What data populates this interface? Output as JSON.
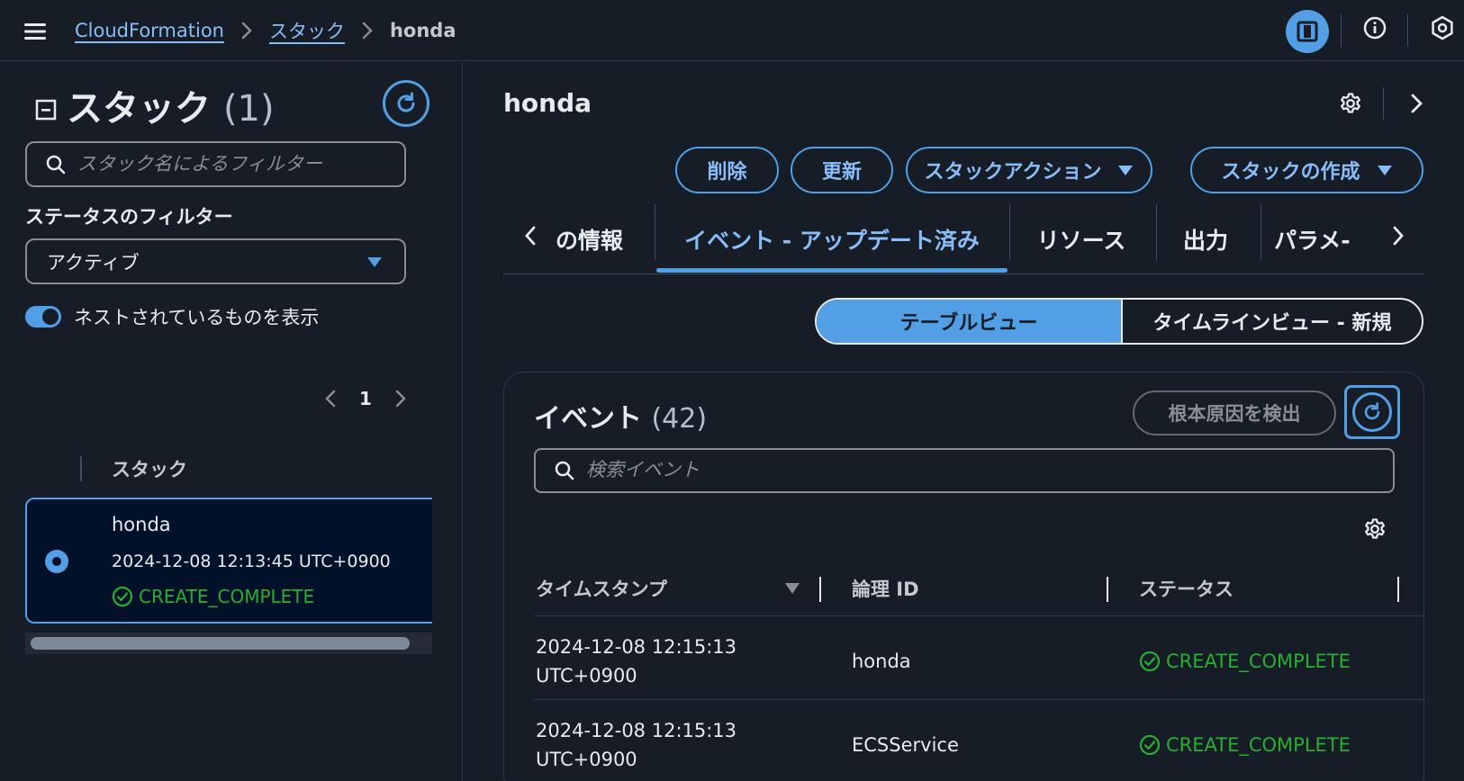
{
  "breadcrumb": {
    "items": [
      "CloudFormation",
      "スタック"
    ],
    "current": "honda"
  },
  "topbar_icons": [
    "menu-icon",
    "panel-icon",
    "info-icon",
    "hex-settings-icon"
  ],
  "left_panel": {
    "title": "スタック",
    "count": "(1)",
    "search_placeholder": "スタック名によるフィルター",
    "status_filter_label": "ステータスのフィルター",
    "status_filter_value": "アクティブ",
    "nested_toggle_label": "ネストされているものを表示",
    "nested_toggle_on": true,
    "page": "1",
    "column_header": "スタック",
    "stacks": [
      {
        "name": "honda",
        "created": "2024-12-08 12:13:45 UTC+0900",
        "status": "CREATE_COMPLETE",
        "selected": true
      }
    ]
  },
  "main": {
    "title": "honda",
    "buttons": {
      "delete": "削除",
      "update": "更新",
      "stack_actions": "スタックアクション",
      "create_stack": "スタックの作成"
    },
    "tabs": [
      {
        "label": "の情報",
        "active": false
      },
      {
        "label": "イベント - アップデート済み",
        "active": true
      },
      {
        "label": "リソース",
        "active": false
      },
      {
        "label": "出力",
        "active": false
      },
      {
        "label": "パラメ-",
        "active": false
      }
    ],
    "view_toggle": {
      "table": "テーブルビュー",
      "timeline": "タイムラインビュー - 新規",
      "selected": "table"
    },
    "events": {
      "title": "イベント",
      "count": "(42)",
      "root_cause_button": "根本原因を検出",
      "search_placeholder": "検索イベント",
      "columns": [
        "タイムスタンプ",
        "論理 ID",
        "ステータス"
      ],
      "rows": [
        {
          "timestamp_line1": "2024-12-08 12:15:13",
          "timestamp_line2": "UTC+0900",
          "logical_id": "honda",
          "status": "CREATE_COMPLETE"
        },
        {
          "timestamp_line1": "2024-12-08 12:15:13",
          "timestamp_line2": "UTC+0900",
          "logical_id": "ECSService",
          "status": "CREATE_COMPLETE"
        }
      ]
    }
  },
  "colors": {
    "background": "#161d26",
    "accent": "#539fe5",
    "link": "#89bdf9",
    "success": "#29ad32",
    "selected_card": "#001129"
  }
}
